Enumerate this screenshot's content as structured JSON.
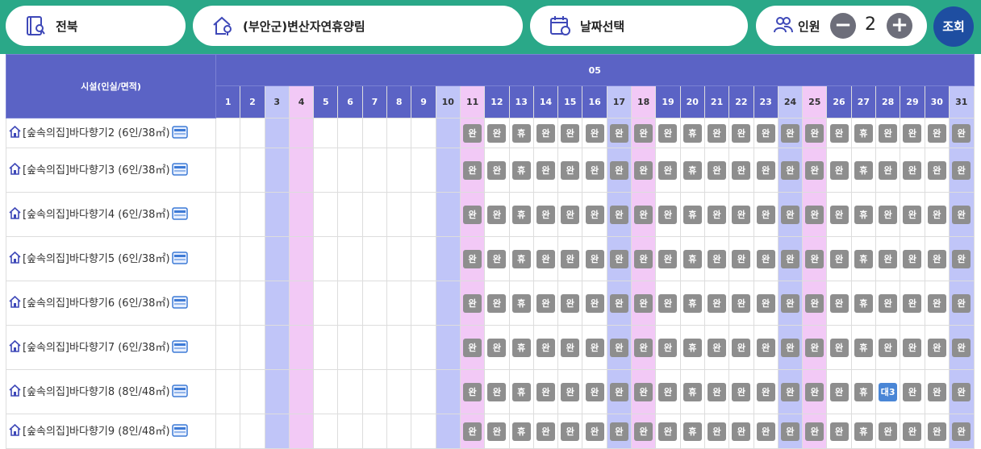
{
  "topbar": {
    "region": "전북",
    "facility": "(부안군)변산자연휴양림",
    "date_placeholder": "날짜선택",
    "people_label": "인원",
    "minus": "−",
    "plus": "+",
    "count": "2",
    "search": "조회"
  },
  "calendar": {
    "header_facility": "시설(인실/면적)",
    "month": "05",
    "days": [
      "1",
      "2",
      "3",
      "4",
      "5",
      "6",
      "7",
      "8",
      "9",
      "10",
      "11",
      "12",
      "13",
      "14",
      "15",
      "16",
      "17",
      "18",
      "19",
      "20",
      "21",
      "22",
      "23",
      "24",
      "25",
      "26",
      "27",
      "28",
      "29",
      "30",
      "31"
    ],
    "rows": [
      {
        "name": "[숲속의집]바다향기2 (6인/38㎡)",
        "cells": [
          "",
          "",
          "",
          "",
          "",
          "",
          "",
          "",
          "",
          "",
          "완",
          "완",
          "휴",
          "완",
          "완",
          "완",
          "완",
          "완",
          "완",
          "휴",
          "완",
          "완",
          "완",
          "완",
          "완",
          "완",
          "휴",
          "완",
          "완",
          "완",
          "완"
        ]
      },
      {
        "name": "[숲속의집]바다향기3 (6인/38㎡)",
        "cells": [
          "",
          "",
          "",
          "",
          "",
          "",
          "",
          "",
          "",
          "",
          "완",
          "완",
          "휴",
          "완",
          "완",
          "완",
          "완",
          "완",
          "완",
          "휴",
          "완",
          "완",
          "완",
          "완",
          "완",
          "완",
          "휴",
          "완",
          "완",
          "완",
          "완"
        ]
      },
      {
        "name": "[숲속의집]바다향기4 (6인/38㎡)",
        "cells": [
          "",
          "",
          "",
          "",
          "",
          "",
          "",
          "",
          "",
          "",
          "완",
          "완",
          "휴",
          "완",
          "완",
          "완",
          "완",
          "완",
          "완",
          "휴",
          "완",
          "완",
          "완",
          "완",
          "완",
          "완",
          "휴",
          "완",
          "완",
          "완",
          "완"
        ]
      },
      {
        "name": "[숲속의집]바다향기5 (6인/38㎡)",
        "cells": [
          "",
          "",
          "",
          "",
          "",
          "",
          "",
          "",
          "",
          "",
          "완",
          "완",
          "휴",
          "완",
          "완",
          "완",
          "완",
          "완",
          "완",
          "휴",
          "완",
          "완",
          "완",
          "완",
          "완",
          "완",
          "휴",
          "완",
          "완",
          "완",
          "완"
        ]
      },
      {
        "name": "[숲속의집]바다향기6 (6인/38㎡)",
        "cells": [
          "",
          "",
          "",
          "",
          "",
          "",
          "",
          "",
          "",
          "",
          "완",
          "완",
          "휴",
          "완",
          "완",
          "완",
          "완",
          "완",
          "완",
          "휴",
          "완",
          "완",
          "완",
          "완",
          "완",
          "완",
          "휴",
          "완",
          "완",
          "완",
          "완"
        ]
      },
      {
        "name": "[숲속의집]바다향기7 (6인/38㎡)",
        "cells": [
          "",
          "",
          "",
          "",
          "",
          "",
          "",
          "",
          "",
          "",
          "완",
          "완",
          "휴",
          "완",
          "완",
          "완",
          "완",
          "완",
          "완",
          "휴",
          "완",
          "완",
          "완",
          "완",
          "완",
          "완",
          "휴",
          "완",
          "완",
          "완",
          "완"
        ]
      },
      {
        "name": "[숲속의집]바다향기8 (8인/48㎡)",
        "cells": [
          "",
          "",
          "",
          "",
          "",
          "",
          "",
          "",
          "",
          "",
          "완",
          "완",
          "휴",
          "완",
          "완",
          "완",
          "완",
          "완",
          "완",
          "휴",
          "완",
          "완",
          "완",
          "완",
          "완",
          "완",
          "휴",
          "대3",
          "완",
          "완",
          "완"
        ]
      },
      {
        "name": "[숲속의집]바다향기9 (8인/48㎡)",
        "cells": [
          "",
          "",
          "",
          "",
          "",
          "",
          "",
          "",
          "",
          "",
          "완",
          "완",
          "휴",
          "완",
          "완",
          "완",
          "완",
          "완",
          "완",
          "휴",
          "완",
          "완",
          "완",
          "완",
          "완",
          "완",
          "휴",
          "완",
          "완",
          "완",
          "완"
        ]
      }
    ]
  },
  "colors": {
    "topbar": "#2aa888",
    "header": "#5b63c5",
    "saturday": "#c0c5f8",
    "sunday": "#f2c9f6",
    "badge_gray": "#8e8e8e",
    "badge_blue": "#4a86d6",
    "search_btn": "#1e4ea1"
  },
  "icons": {
    "region": "map-book-icon",
    "facility": "house-pin-icon",
    "date": "calendar-icon",
    "people": "people-icon",
    "row": "house-icon",
    "info": "monitor-icon"
  }
}
